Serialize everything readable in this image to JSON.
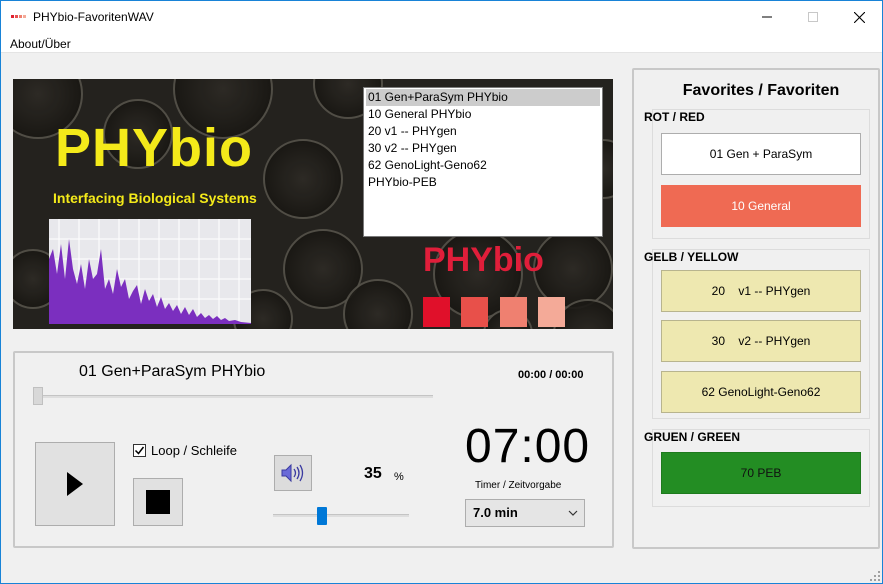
{
  "window": {
    "title": "PHYbio-FavoritenWAV",
    "minimize_icon": "minimize-icon",
    "maximize_icon": "maximize-icon",
    "close_icon": "close-icon"
  },
  "menu": {
    "items": [
      "About/Über"
    ]
  },
  "banner": {
    "title": "PHYbio",
    "subtitle": "Interfacing Biological Systems",
    "logo_text": "PHYbio",
    "colors": {
      "title": "#f4ea1a",
      "logo": "#e01e3a",
      "spectrum": "#7b2fbf"
    },
    "swatches": [
      "#e0102a",
      "#e8504a",
      "#ef8070",
      "#f4aa98"
    ]
  },
  "playlist": {
    "items": [
      "01 Gen+ParaSym PHYbio",
      "10 General PHYbio",
      "20 v1 -- PHYgen",
      "30 v2 -- PHYgen",
      "62 GenoLight-Geno62",
      "PHYbio-PEB"
    ],
    "selected_index": 0
  },
  "player": {
    "track_name": "01 Gen+ParaSym PHYbio",
    "time_display": "00:00 / 00:00",
    "seek_position": 0,
    "loop_label": "Loop / Schleife",
    "loop_checked": true,
    "play_icon": "play-icon",
    "stop_icon": "stop-icon",
    "speaker_icon": "speaker-icon",
    "volume_value": "35",
    "volume_unit": "%",
    "volume_level": 0.35,
    "timer_display": "07:00",
    "timer_label": "Timer / Zeitvorgabe",
    "timer_selected": "7.0 min"
  },
  "favorites": {
    "title": "Favorites / Favoriten",
    "groups": [
      {
        "label": "ROT / RED",
        "buttons": [
          {
            "label": "01 Gen + ParaSym",
            "color": "#ffffff"
          },
          {
            "label": "10 General",
            "color": "#ef6a53"
          }
        ]
      },
      {
        "label": "GELB / YELLOW",
        "buttons": [
          {
            "label": "20    v1 -- PHYgen",
            "color": "#eee8b0"
          },
          {
            "label": "30    v2 -- PHYgen",
            "color": "#eee8b0"
          },
          {
            "label": "62 GenoLight-Geno62",
            "color": "#eee8b0"
          }
        ]
      },
      {
        "label": "GRUEN / GREEN",
        "buttons": [
          {
            "label": "70 PEB",
            "color": "#238d23"
          }
        ]
      }
    ]
  }
}
